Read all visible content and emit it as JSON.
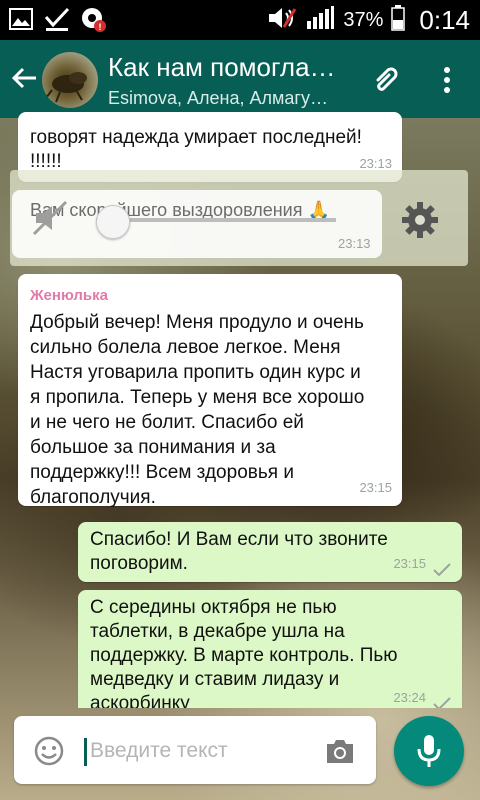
{
  "status_bar": {
    "battery_percent": "37%",
    "time": "0:14",
    "notification_badge": "!"
  },
  "header": {
    "title": "Как нам помогла…",
    "subtitle": "Esimova, Алена, Алмагу…"
  },
  "messages": [
    {
      "direction": "incoming",
      "text": "говорят надежда умирает последней!\n!!!!!!",
      "time": "23:13"
    },
    {
      "direction": "incoming",
      "type": "audio",
      "text": "Вам скорейшего выздоровления 🙏",
      "time": "23:13"
    },
    {
      "direction": "incoming",
      "sender": "Женюлька",
      "text": "Добрый вечер! Меня продуло и очень\nсильно  болела левое легкое. Меня\nНастя уговарила пропить один курс и\nя пропила. Теперь у меня все хорошо\nи не чего не болит. Спасибо ей\nбольшое за понимания и за\nподдержку!!! Всем здоровья и\nблагополучия.",
      "time": "23:15"
    },
    {
      "direction": "outgoing",
      "text": "Спасибо! И Вам если что звоните\nпоговорим.",
      "time": "23:15"
    },
    {
      "direction": "outgoing",
      "text": "С середины октября не пью\nтаблетки, в декабре ушла на\nподдержку. В марте контроль. Пью\nмедведку и ставим лидазу и\nаскорбинку",
      "time": "23:24"
    }
  ],
  "input": {
    "placeholder": "Введите текст"
  },
  "colors": {
    "app_bar": "#075e54",
    "outgoing_bubble": "#dcf8c6",
    "incoming_bubble": "#ffffff",
    "mic_button": "#05897a",
    "sender_name": "#e07ba9"
  },
  "icons": {
    "status_left": [
      "image-icon",
      "check-icon",
      "record-icon"
    ],
    "status_right": [
      "speaker-icon",
      "signal-icon",
      "battery-icon"
    ],
    "header": [
      "back-arrow-icon",
      "paperclip-icon",
      "more-vert-icon"
    ],
    "audio": [
      "mute-icon",
      "gear-icon"
    ],
    "input": [
      "emoji-icon",
      "camera-icon",
      "mic-icon"
    ]
  }
}
